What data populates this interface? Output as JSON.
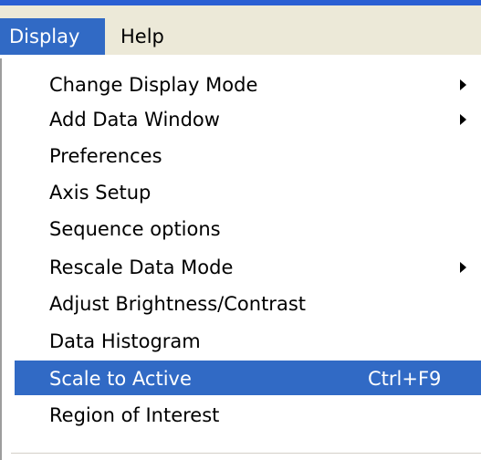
{
  "menubar": {
    "items": [
      {
        "label": "Display"
      },
      {
        "label": "Help"
      }
    ]
  },
  "menu": {
    "items": [
      {
        "label": "Change Display Mode",
        "submenu": true
      },
      {
        "label": "Add Data Window",
        "submenu": true
      },
      {
        "label": "Preferences"
      },
      {
        "label": "Axis Setup"
      },
      {
        "label": "Sequence options"
      },
      {
        "label": "Rescale Data Mode",
        "submenu": true
      },
      {
        "label": "Adjust Brightness/Contrast"
      },
      {
        "label": "Data Histogram"
      },
      {
        "label": "Scale to Active",
        "shortcut": "Ctrl+F9",
        "highlighted": true
      },
      {
        "label": "Region of Interest"
      }
    ]
  },
  "colors": {
    "highlight": "#316ac5",
    "menubar_bg": "#ece9d8",
    "title_strip": "#2a5fd3"
  }
}
